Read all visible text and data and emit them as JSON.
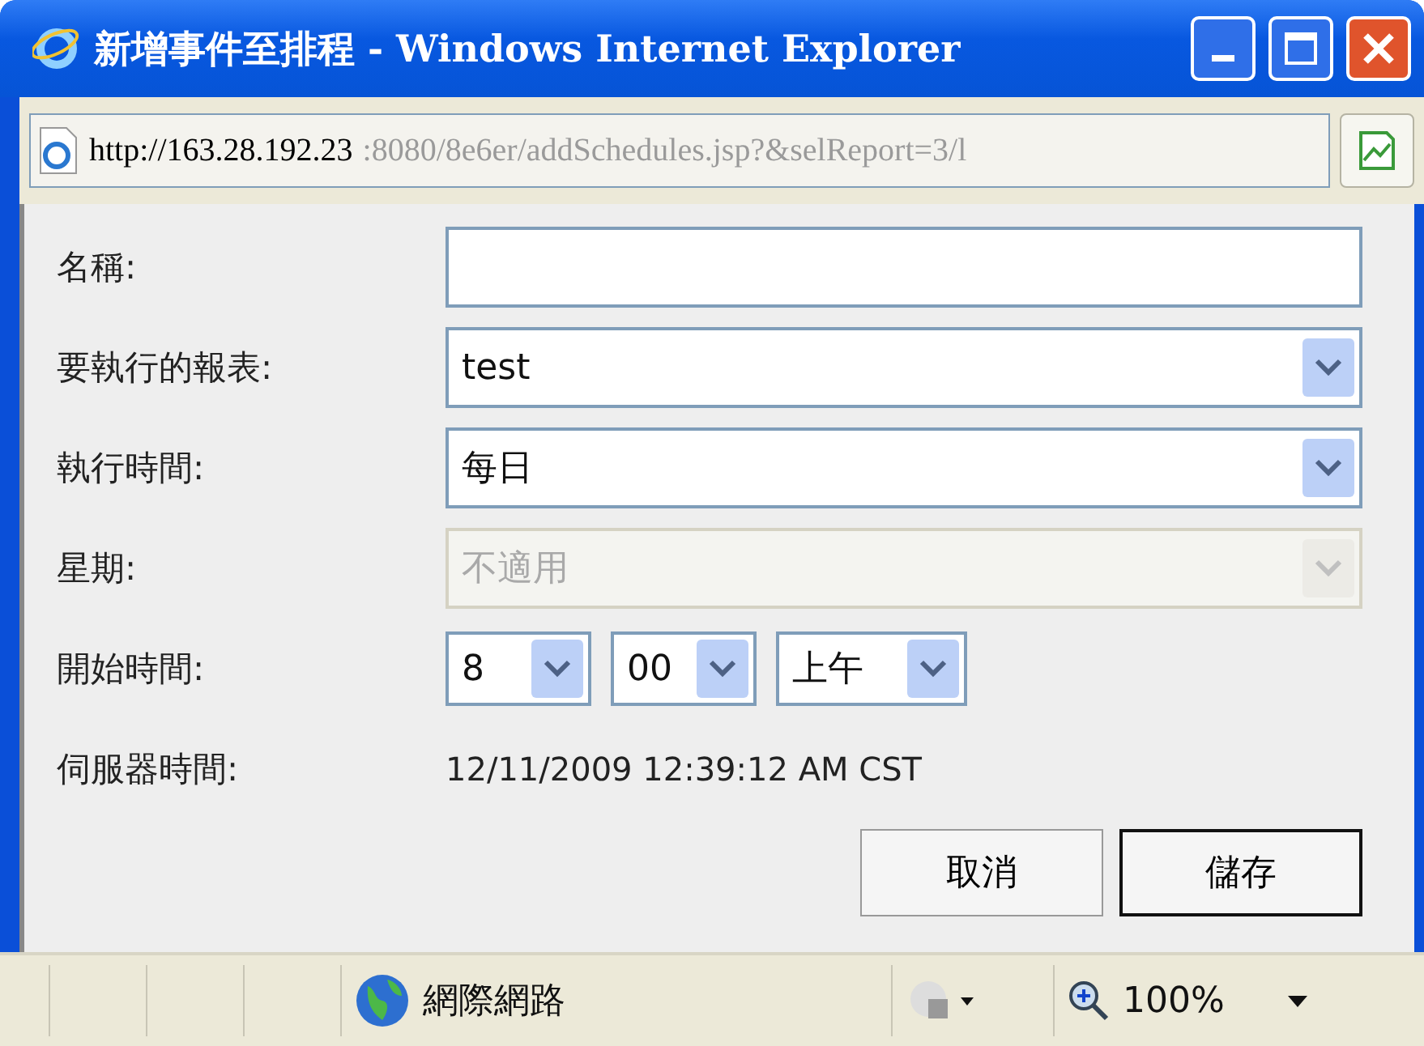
{
  "window": {
    "title": "新增事件至排程 - Windows Internet Explorer"
  },
  "address_bar": {
    "host": "http://163.28.192.23",
    "rest": ":8080/8e6er/addSchedules.jsp?&selReport=3/l"
  },
  "form": {
    "rows": [
      {
        "kind": "text",
        "label": "名稱:",
        "value": ""
      },
      {
        "kind": "select",
        "label": "要執行的報表:",
        "value": "test",
        "disabled": false
      },
      {
        "kind": "select",
        "label": "執行時間:",
        "value": "每日",
        "disabled": false
      },
      {
        "kind": "select",
        "label": "星期:",
        "value": "不適用",
        "disabled": true
      },
      {
        "kind": "time",
        "label": "開始時間:",
        "parts": [
          "8",
          "00",
          "上午"
        ]
      },
      {
        "kind": "info",
        "label": "伺服器時間:",
        "value": "12/11/2009 12:39:12 AM CST"
      }
    ],
    "buttons": [
      {
        "label": "取消",
        "default": false
      },
      {
        "label": "儲存",
        "default": true
      }
    ]
  },
  "status_bar": {
    "zone": "網際網路",
    "zoom": "100%"
  }
}
